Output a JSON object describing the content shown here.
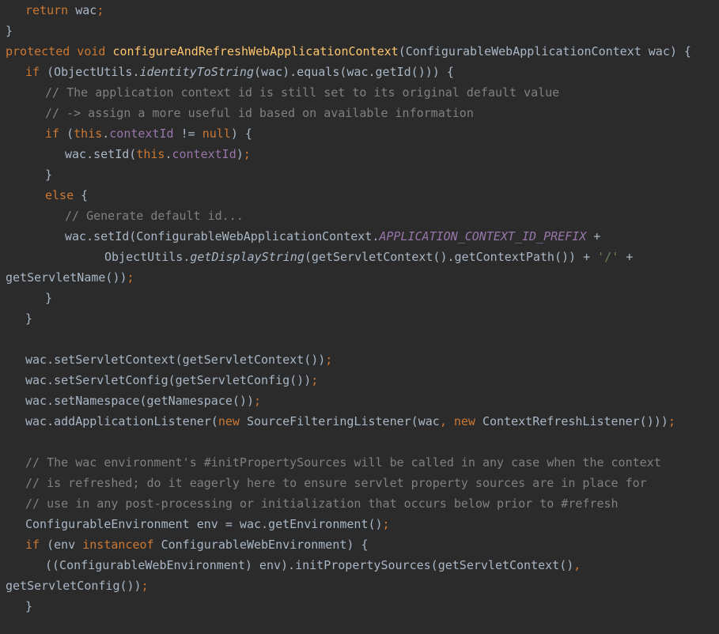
{
  "editor": {
    "lines": [
      {
        "indent": 1,
        "tokens": [
          {
            "t": "return",
            "c": "kw"
          },
          {
            "t": " wac",
            "c": "plain"
          },
          {
            "t": ";",
            "c": "kw"
          }
        ]
      },
      {
        "indent": 0,
        "tokens": [
          {
            "t": "}",
            "c": "plain"
          }
        ]
      },
      {
        "indent": 0,
        "tokens": [
          {
            "t": "protected void ",
            "c": "kw"
          },
          {
            "t": "configureAndRefreshWebApplicationContext",
            "c": "fn"
          },
          {
            "t": "(ConfigurableWebApplicationContext wac) {",
            "c": "plain"
          }
        ]
      },
      {
        "indent": 1,
        "tokens": [
          {
            "t": "if ",
            "c": "kw"
          },
          {
            "t": "(ObjectUtils.",
            "c": "plain"
          },
          {
            "t": "identityToString",
            "c": "it"
          },
          {
            "t": "(wac).equals(wac.getId())) {",
            "c": "plain"
          }
        ]
      },
      {
        "indent": 2,
        "tokens": [
          {
            "t": "// The application context id is still set to its original default value",
            "c": "cm"
          }
        ]
      },
      {
        "indent": 2,
        "tokens": [
          {
            "t": "// -> assign a more useful id based on available information",
            "c": "cm"
          }
        ]
      },
      {
        "indent": 2,
        "tokens": [
          {
            "t": "if ",
            "c": "kw"
          },
          {
            "t": "(",
            "c": "plain"
          },
          {
            "t": "this",
            "c": "kw"
          },
          {
            "t": ".",
            "c": "plain"
          },
          {
            "t": "contextId",
            "c": "fld"
          },
          {
            "t": " != ",
            "c": "plain"
          },
          {
            "t": "null",
            "c": "kw"
          },
          {
            "t": ") {",
            "c": "plain"
          }
        ]
      },
      {
        "indent": 3,
        "tokens": [
          {
            "t": "wac.setId(",
            "c": "plain"
          },
          {
            "t": "this",
            "c": "kw"
          },
          {
            "t": ".",
            "c": "plain"
          },
          {
            "t": "contextId",
            "c": "fld"
          },
          {
            "t": ")",
            "c": "plain"
          },
          {
            "t": ";",
            "c": "kw"
          }
        ]
      },
      {
        "indent": 2,
        "tokens": [
          {
            "t": "}",
            "c": "plain"
          }
        ]
      },
      {
        "indent": 2,
        "tokens": [
          {
            "t": "else ",
            "c": "kw"
          },
          {
            "t": "{",
            "c": "plain"
          }
        ]
      },
      {
        "indent": 3,
        "tokens": [
          {
            "t": "// Generate default id...",
            "c": "cm"
          }
        ]
      },
      {
        "indent": 3,
        "tokens": [
          {
            "t": "wac.setId(ConfigurableWebApplicationContext.",
            "c": "plain"
          },
          {
            "t": "APPLICATION_CONTEXT_ID_PREFIX",
            "c": "const"
          },
          {
            "t": " +",
            "c": "plain"
          }
        ]
      },
      {
        "indent": 5,
        "tokens": [
          {
            "t": "ObjectUtils.",
            "c": "plain"
          },
          {
            "t": "getDisplayString",
            "c": "it"
          },
          {
            "t": "(getServletContext().getContextPath()) + ",
            "c": "plain"
          },
          {
            "t": "'/'",
            "c": "str"
          },
          {
            "t": " +",
            "c": "plain"
          }
        ]
      },
      {
        "indent": 0,
        "tokens": [
          {
            "t": "getServletName())",
            "c": "plain"
          },
          {
            "t": ";",
            "c": "kw"
          }
        ]
      },
      {
        "indent": 2,
        "tokens": [
          {
            "t": "}",
            "c": "plain"
          }
        ]
      },
      {
        "indent": 1,
        "tokens": [
          {
            "t": "}",
            "c": "plain"
          }
        ]
      },
      {
        "indent": 0,
        "tokens": []
      },
      {
        "indent": 1,
        "tokens": [
          {
            "t": "wac.setServletContext(getServletContext())",
            "c": "plain"
          },
          {
            "t": ";",
            "c": "kw"
          }
        ]
      },
      {
        "indent": 1,
        "tokens": [
          {
            "t": "wac.setServletConfig(getServletConfig())",
            "c": "plain"
          },
          {
            "t": ";",
            "c": "kw"
          }
        ]
      },
      {
        "indent": 1,
        "tokens": [
          {
            "t": "wac.setNamespace(getNamespace())",
            "c": "plain"
          },
          {
            "t": ";",
            "c": "kw"
          }
        ]
      },
      {
        "indent": 1,
        "tokens": [
          {
            "t": "wac.addApplicationListener(",
            "c": "plain"
          },
          {
            "t": "new ",
            "c": "kw"
          },
          {
            "t": "SourceFilteringListener(wac",
            "c": "plain"
          },
          {
            "t": ", ",
            "c": "kw"
          },
          {
            "t": "new ",
            "c": "kw"
          },
          {
            "t": "ContextRefreshListener()))",
            "c": "plain"
          },
          {
            "t": ";",
            "c": "kw"
          }
        ]
      },
      {
        "indent": 0,
        "tokens": []
      },
      {
        "indent": 1,
        "tokens": [
          {
            "t": "// The wac environment's #initPropertySources will be called in any case when the context",
            "c": "cm"
          }
        ]
      },
      {
        "indent": 1,
        "tokens": [
          {
            "t": "// is refreshed; do it eagerly here to ensure servlet property sources are in place for",
            "c": "cm"
          }
        ]
      },
      {
        "indent": 1,
        "tokens": [
          {
            "t": "// use in any post-processing or initialization that occurs below prior to #refresh",
            "c": "cm"
          }
        ]
      },
      {
        "indent": 1,
        "tokens": [
          {
            "t": "ConfigurableEnvironment env = wac.getEnvironment()",
            "c": "plain"
          },
          {
            "t": ";",
            "c": "kw"
          }
        ]
      },
      {
        "indent": 1,
        "tokens": [
          {
            "t": "if ",
            "c": "kw"
          },
          {
            "t": "(env ",
            "c": "plain"
          },
          {
            "t": "instanceof ",
            "c": "kw"
          },
          {
            "t": "ConfigurableWebEnvironment) {",
            "c": "plain"
          }
        ]
      },
      {
        "indent": 2,
        "tokens": [
          {
            "t": "((ConfigurableWebEnvironment) env).initPropertySources(getServletContext()",
            "c": "plain"
          },
          {
            "t": ",",
            "c": "kw"
          }
        ]
      },
      {
        "indent": 0,
        "tokens": [
          {
            "t": "getServletConfig())",
            "c": "plain"
          },
          {
            "t": ";",
            "c": "kw"
          }
        ]
      },
      {
        "indent": 1,
        "tokens": [
          {
            "t": "}",
            "c": "plain"
          }
        ]
      }
    ]
  }
}
